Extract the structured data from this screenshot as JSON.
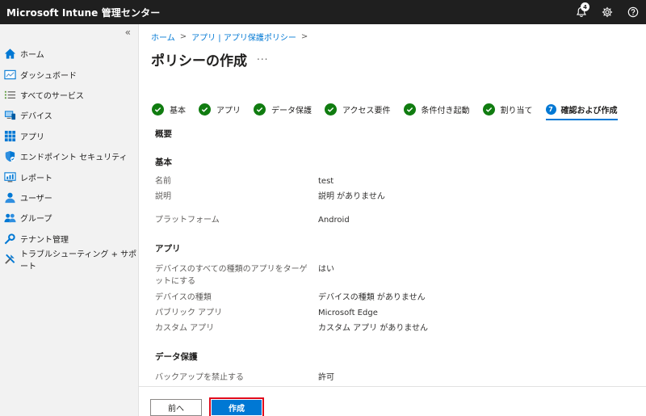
{
  "app": {
    "title": "Microsoft Intune 管理センター",
    "notification_count": "4"
  },
  "sidebar": {
    "collapse_glyph": "«",
    "items": [
      {
        "label": "ホーム",
        "icon": "home-icon"
      },
      {
        "label": "ダッシュボード",
        "icon": "dashboard-icon"
      },
      {
        "label": "すべてのサービス",
        "icon": "list-icon"
      },
      {
        "label": "デバイス",
        "icon": "devices-icon"
      },
      {
        "label": "アプリ",
        "icon": "apps-icon"
      },
      {
        "label": "エンドポイント セキュリティ",
        "icon": "shield-icon"
      },
      {
        "label": "レポート",
        "icon": "reports-icon"
      },
      {
        "label": "ユーザー",
        "icon": "user-icon"
      },
      {
        "label": "グループ",
        "icon": "group-icon"
      },
      {
        "label": "テナント管理",
        "icon": "tenant-icon"
      },
      {
        "label": "トラブルシューティング + サポート",
        "icon": "troubleshoot-icon"
      }
    ]
  },
  "breadcrumb": [
    "ホーム",
    "アプリ | アプリ保護ポリシー"
  ],
  "page": {
    "title": "ポリシーの作成",
    "more": "..."
  },
  "steps": [
    {
      "label": "基本",
      "done": true
    },
    {
      "label": "アプリ",
      "done": true
    },
    {
      "label": "データ保護",
      "done": true
    },
    {
      "label": "アクセス要件",
      "done": true
    },
    {
      "label": "条件付き起動",
      "done": true
    },
    {
      "label": "割り当て",
      "done": true
    },
    {
      "label": "確認および作成",
      "number": "7",
      "active": true
    }
  ],
  "summary": {
    "heading": "概要",
    "basics": {
      "heading": "基本",
      "name_label": "名前",
      "name_value": "test",
      "desc_label": "説明",
      "desc_value": "説明 がありません",
      "platform_label": "プラットフォーム",
      "platform_value": "Android"
    },
    "apps": {
      "heading": "アプリ",
      "target_label": "デバイスのすべての種類のアプリをターゲットにする",
      "target_value": "はい",
      "devtype_label": "デバイスの種類",
      "devtype_value": "デバイスの種類 がありません",
      "public_label": "パブリック アプリ",
      "public_value": "Microsoft Edge",
      "custom_label": "カスタム アプリ",
      "custom_value": "カスタム アプリ がありません"
    },
    "data_protection": {
      "heading": "データ保護",
      "backup_label": "バックアップを禁止する",
      "backup_value": "許可"
    }
  },
  "footer": {
    "back_label": "前へ",
    "create_label": "作成"
  },
  "colors": {
    "accent": "#0078d4",
    "success": "#107c10",
    "highlight": "#e00b1c",
    "topbar": "#1f1f1f"
  }
}
